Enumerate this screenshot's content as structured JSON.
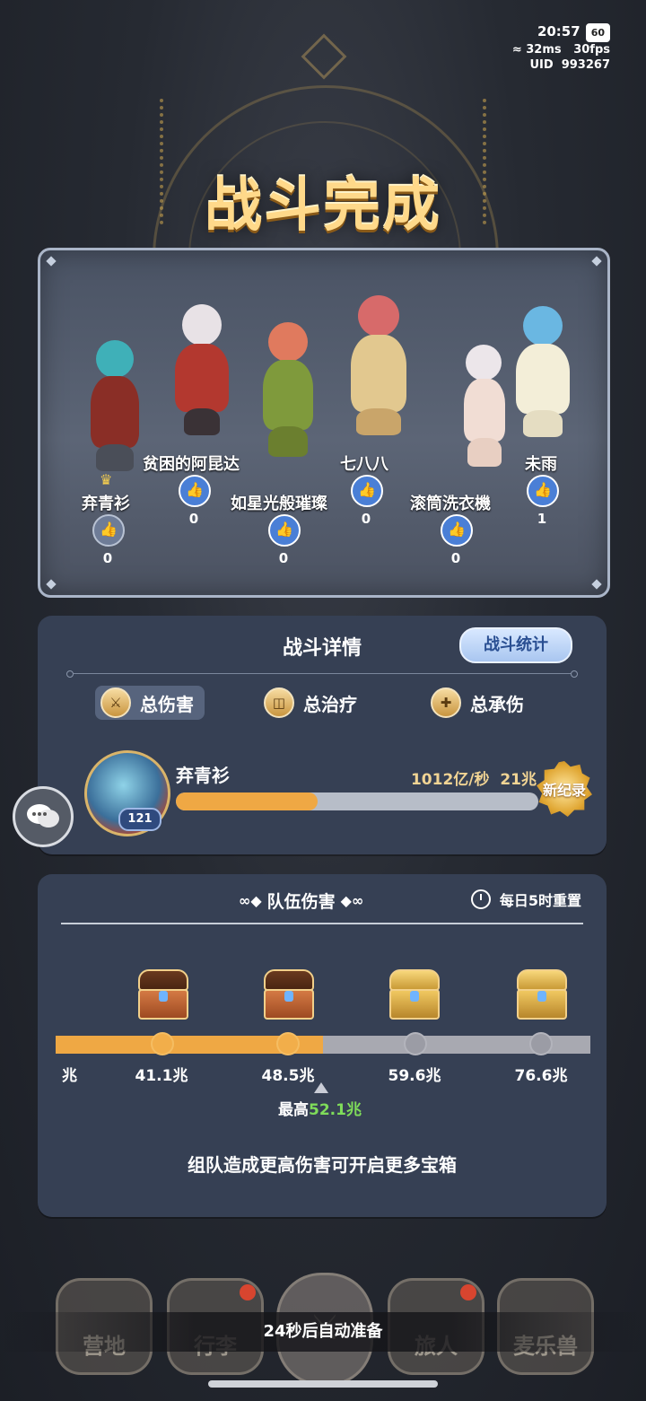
{
  "status": {
    "time": "20:57",
    "battery": "60",
    "ping": "32ms",
    "fps": "30fps",
    "uid": "UID  993267"
  },
  "title": "战斗完成",
  "characters": [
    {
      "name": "弃青衫",
      "likes": "0",
      "crown": true
    },
    {
      "name": "贫困的阿昆达",
      "likes": "0"
    },
    {
      "name": "如星光般璀璨",
      "likes": "0"
    },
    {
      "name": "七八八",
      "likes": "0"
    },
    {
      "name": "滚筒洗衣機",
      "likes": "0"
    },
    {
      "name": "未雨",
      "likes": "1"
    }
  ],
  "details": {
    "title": "战斗详情",
    "stats_button": "战斗统计",
    "tabs": [
      {
        "label": "总伤害",
        "icon": "sword-icon",
        "active": true
      },
      {
        "label": "总治疗",
        "icon": "shield-icon",
        "active": false
      },
      {
        "label": "总承伤",
        "icon": "cross-icon",
        "active": false
      }
    ],
    "hero": {
      "name": "弃青衫",
      "level": "121",
      "damage": "1012亿/秒  21兆",
      "progress": 0.39,
      "badge": "新纪录"
    }
  },
  "team": {
    "title": "队伍伤害",
    "reset": "每日5时重置",
    "partial_label": "兆",
    "thresholds": [
      "41.1兆",
      "48.5兆",
      "59.6兆",
      "76.6兆"
    ],
    "progress": 0.5,
    "max_label": "最高",
    "max_value": "52.1兆",
    "tip": "组队造成更高伤害可开启更多宝箱"
  },
  "nav": {
    "items": [
      "营地",
      "行李",
      "",
      "旅人",
      "麦乐兽"
    ],
    "auto_ready": "24秒后自动准备"
  },
  "colors": {
    "accent": "#efa844",
    "like": "#4a7fd6",
    "max_value": "#7fdc5a",
    "card": "#364054"
  }
}
